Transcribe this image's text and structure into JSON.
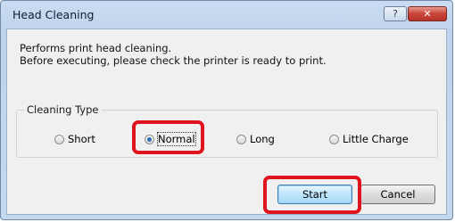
{
  "window": {
    "title": "Head Cleaning",
    "help_glyph": "?",
    "close_glyph": "✕"
  },
  "description": {
    "line1": "Performs print head cleaning.",
    "line2": "Before executing, please check the printer is ready to print."
  },
  "cleaning_type": {
    "label": "Cleaning Type",
    "options": [
      {
        "label": "Short",
        "checked": false
      },
      {
        "label": "Normal",
        "checked": true
      },
      {
        "label": "Long",
        "checked": false
      },
      {
        "label": "Little Charge",
        "checked": false
      }
    ]
  },
  "buttons": {
    "start": "Start",
    "cancel": "Cancel"
  },
  "colors": {
    "highlight": "#e0141e",
    "radio_selected": "#2a6fb7"
  }
}
